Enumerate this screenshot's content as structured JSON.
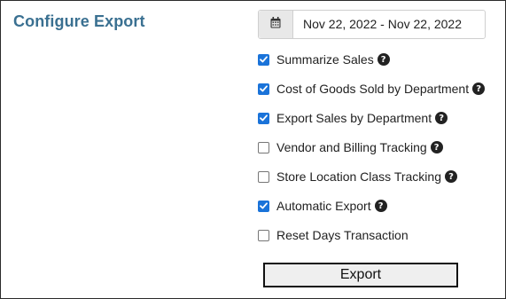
{
  "header": {
    "title": "Configure Export"
  },
  "date_range": {
    "value": "Nov 22, 2022 - Nov 22, 2022",
    "icon": "calendar-icon"
  },
  "options": [
    {
      "label": "Summarize Sales",
      "checked": true,
      "help": true
    },
    {
      "label": "Cost of Goods Sold by Department",
      "checked": true,
      "help": true
    },
    {
      "label": "Export Sales by Department",
      "checked": true,
      "help": true
    },
    {
      "label": "Vendor and Billing Tracking",
      "checked": false,
      "help": true
    },
    {
      "label": "Store Location Class Tracking",
      "checked": false,
      "help": true
    },
    {
      "label": "Automatic Export",
      "checked": true,
      "help": true
    },
    {
      "label": "Reset Days Transaction",
      "checked": false,
      "help": false
    }
  ],
  "help_glyph": "?",
  "export_button": {
    "label": "Export"
  },
  "colors": {
    "title": "#3a7091",
    "checkbox_checked": "#1a73d9"
  }
}
